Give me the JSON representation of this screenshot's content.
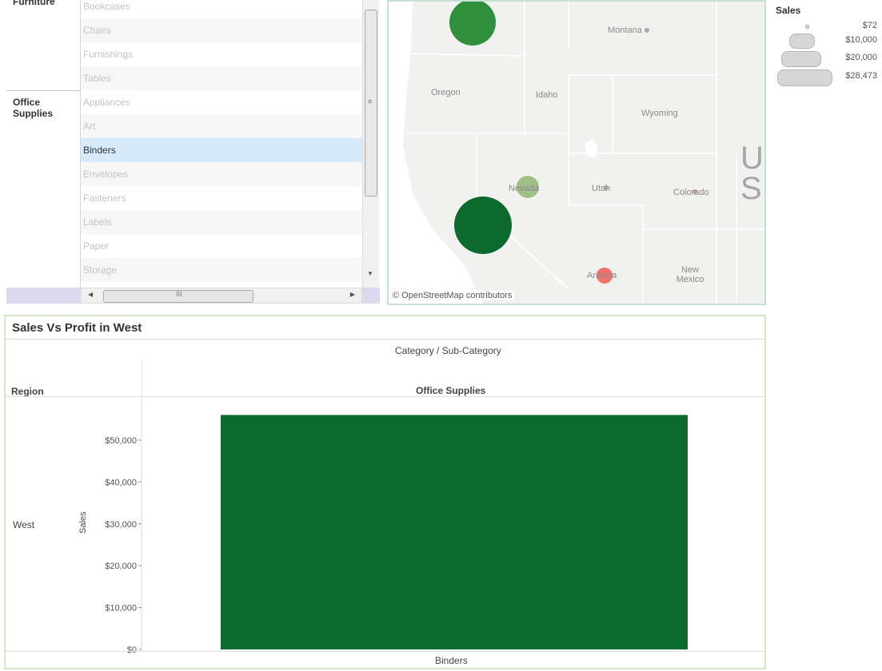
{
  "list": {
    "categories": [
      {
        "label": "Furniture"
      },
      {
        "label": "Office Supplies"
      }
    ],
    "sub_categories": [
      {
        "label": "Bookcases"
      },
      {
        "label": "Chairs"
      },
      {
        "label": "Furnishings"
      },
      {
        "label": "Tables"
      },
      {
        "label": "Appliances"
      },
      {
        "label": "Art"
      },
      {
        "label": "Binders",
        "selected": true
      },
      {
        "label": "Envelopes"
      },
      {
        "label": "Fasteners"
      },
      {
        "label": "Labels"
      },
      {
        "label": "Paper"
      },
      {
        "label": "Storage"
      }
    ],
    "scroll_grip": "≡",
    "hscroll_grip": "III",
    "arrow_left": "◀",
    "arrow_right": "▶",
    "arrow_down": "▼"
  },
  "map": {
    "attribution": "© OpenStreetMap contributors",
    "labels": [
      "Montana",
      "Oregon",
      "Idaho",
      "Wyoming",
      "Nevada",
      "Utah",
      "Colorado",
      "Arizona",
      "New Mexico"
    ],
    "big_letters": [
      "U",
      "S"
    ],
    "colors": {
      "dark_green": "#0b6b2e",
      "green": "#2f8f3a",
      "light_green": "#9fbf87",
      "salmon": "#f4716b",
      "land": "#f1f1f0",
      "border": "#ffffff"
    }
  },
  "legend": {
    "title": "Sales",
    "values": [
      "$72",
      "$10,000",
      "$20,000",
      "$28,473"
    ]
  },
  "chart": {
    "title": "Sales Vs Profit in West",
    "column_header": "Category  /  Sub-Category",
    "row_header": "Region",
    "category": "Office Supplies",
    "region": "West",
    "y_axis_label": "Sales",
    "x_label": "Binders",
    "bar_color": "#0b6b2e"
  },
  "chart_data": {
    "type": "bar",
    "title": "Sales Vs Profit in West",
    "categories": [
      "Binders"
    ],
    "values": [
      56000
    ],
    "ylabel": "Sales",
    "ylim": [
      0,
      58000
    ],
    "yticks": [
      "$0",
      "$10,000",
      "$20,000",
      "$30,000",
      "$40,000",
      "$50,000"
    ],
    "grid": false
  }
}
